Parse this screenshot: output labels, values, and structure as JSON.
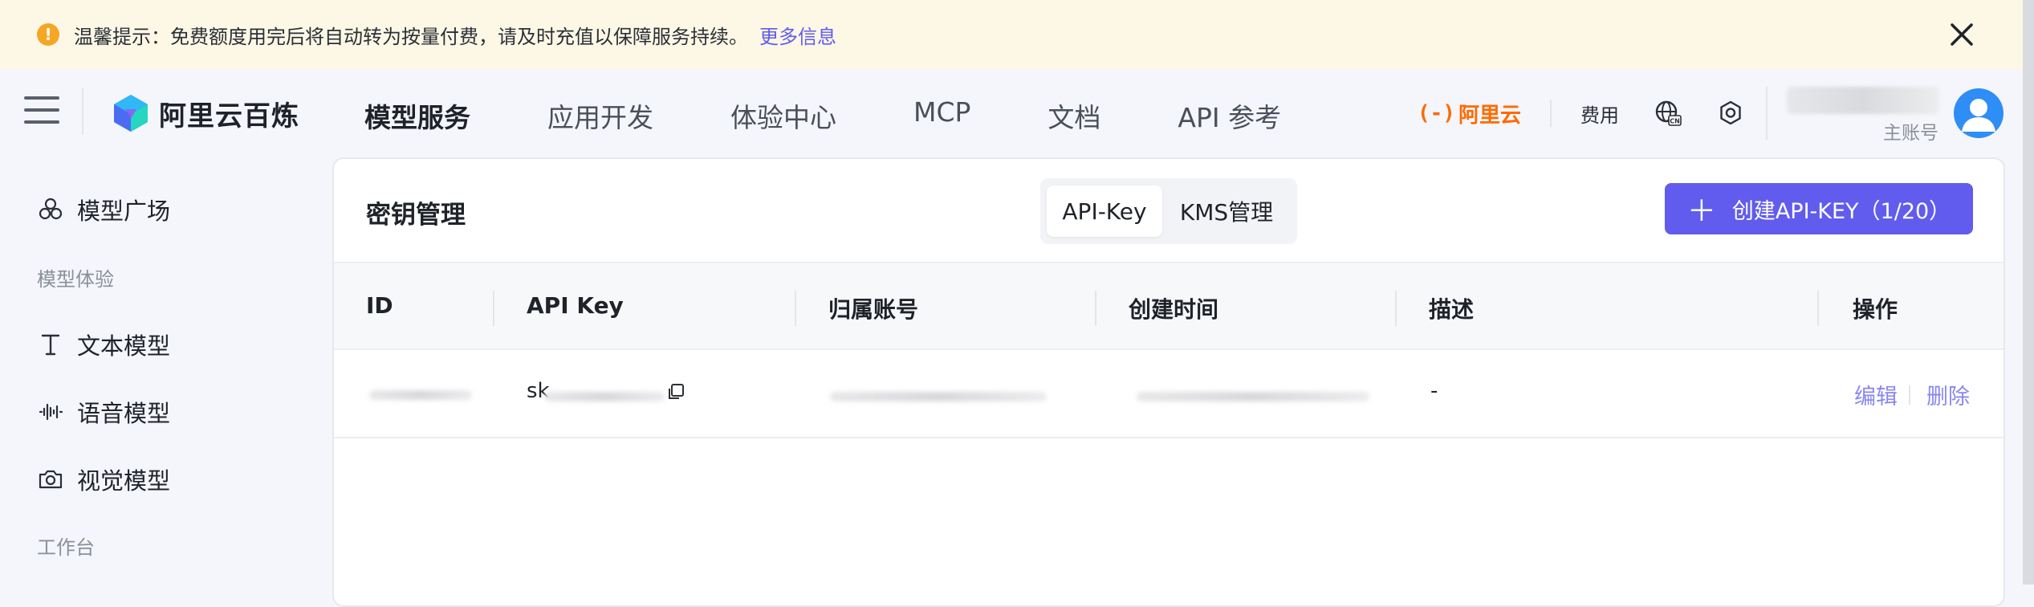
{
  "notice": {
    "text": "温馨提示：免费额度用完后将自动转为按量付费，请及时充值以保障服务持续。",
    "more_link": "更多信息",
    "warn_glyph": "!"
  },
  "header": {
    "logo_text": "阿里云百炼",
    "nav": [
      "模型服务",
      "应用开发",
      "体验中心",
      "MCP",
      "文档",
      "API 参考"
    ],
    "aliyun_label": "阿里云",
    "aliyun_bracket": "(-)",
    "fee_label": "费用",
    "main_account": "主账号"
  },
  "sidebar": {
    "model_square": "模型广场",
    "group_experience": "模型体验",
    "text_model": "文本模型",
    "voice_model": "语音模型",
    "vision_model": "视觉模型",
    "group_workbench": "工作台"
  },
  "card": {
    "title": "密钥管理",
    "tabs": [
      "API-Key",
      "KMS管理"
    ],
    "create_button": "创建API-KEY（1/20）"
  },
  "table": {
    "columns": [
      "ID",
      "API Key",
      "归属账号",
      "创建时间",
      "描述",
      "操作"
    ],
    "rows": [
      {
        "key_prefix": "sk",
        "description": "-",
        "edit": "编辑",
        "delete": "删除"
      }
    ]
  },
  "colors": {
    "accent": "#615ced",
    "notice_bg": "#fdf8e6",
    "aliyun_orange": "#ff6a00"
  }
}
